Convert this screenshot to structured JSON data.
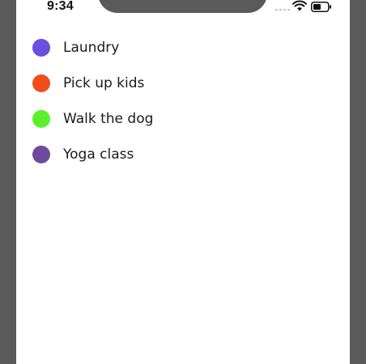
{
  "status_bar": {
    "time": "9:34"
  },
  "tasks": [
    {
      "label": "Laundry",
      "color": "#6a4fe0"
    },
    {
      "label": "Pick up kids",
      "color": "#f04d1a"
    },
    {
      "label": "Walk the dog",
      "color": "#5cf02a"
    },
    {
      "label": "Yoga class",
      "color": "#6e4a9e"
    }
  ]
}
